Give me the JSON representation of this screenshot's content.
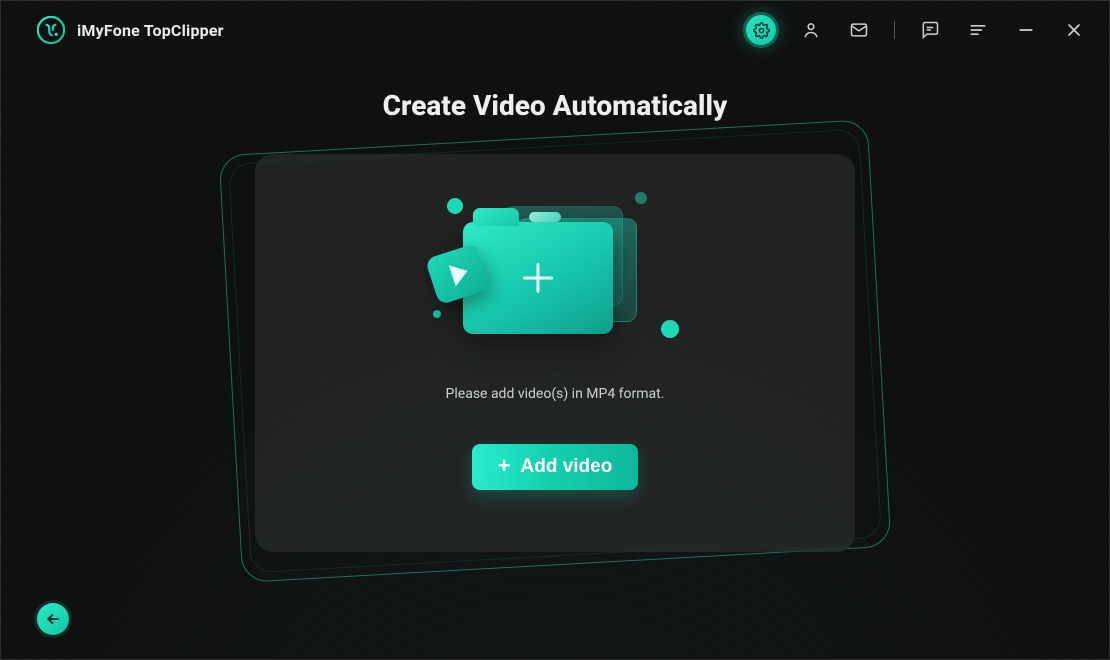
{
  "app": {
    "title": "iMyFone TopClipper"
  },
  "toolbar": {
    "icons": [
      "settings-icon",
      "account-icon",
      "mail-icon",
      "feedback-icon",
      "menu-icon",
      "minimize-icon",
      "close-icon"
    ]
  },
  "main": {
    "title": "Create Video Automatically",
    "hint": "Please add video(s) in MP4 format.",
    "add_button_label": "Add video"
  },
  "colors": {
    "accent": "#1fd8b6",
    "accent_dark": "#0fb79c",
    "bg": "#0f1010"
  }
}
